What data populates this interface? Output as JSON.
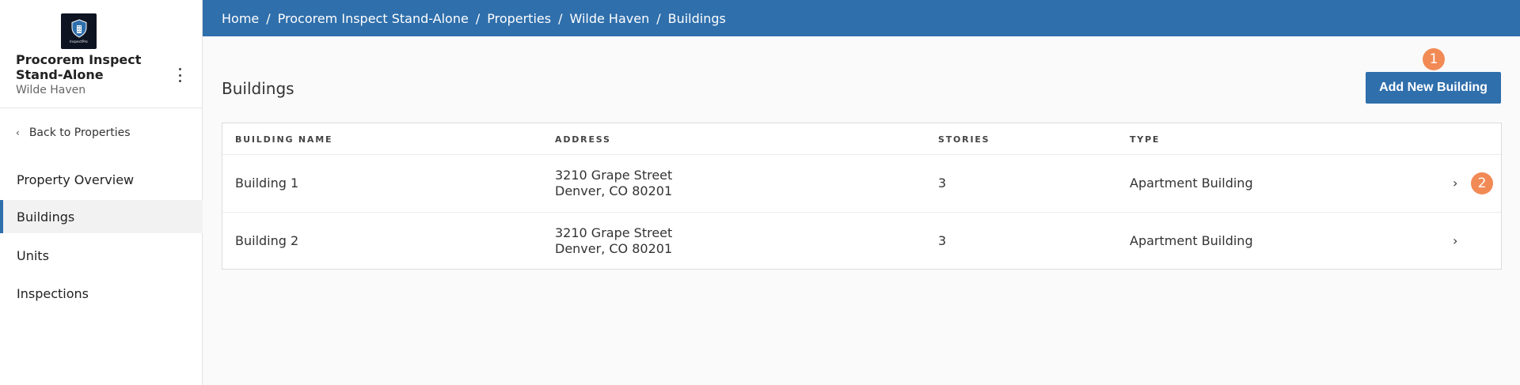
{
  "sidebar": {
    "logo_text": "InspectPro",
    "org_name": "Procorem Inspect Stand-Alone",
    "org_sub": "Wilde Haven",
    "back_label": "Back to Properties",
    "nav": [
      {
        "label": "Property Overview",
        "active": false
      },
      {
        "label": "Buildings",
        "active": true
      },
      {
        "label": "Units",
        "active": false
      },
      {
        "label": "Inspections",
        "active": false
      }
    ]
  },
  "breadcrumb": [
    "Home",
    "Procorem Inspect Stand-Alone",
    "Properties",
    "Wilde Haven",
    "Buildings"
  ],
  "main": {
    "title": "Buildings",
    "add_button": "Add New Building",
    "badge_1": "1",
    "badge_2": "2"
  },
  "table": {
    "headers": [
      "BUILDING NAME",
      "ADDRESS",
      "STORIES",
      "TYPE"
    ],
    "rows": [
      {
        "name": "Building 1",
        "address_line1": "3210 Grape Street",
        "address_line2": "Denver, CO 80201",
        "stories": "3",
        "type": "Apartment Building"
      },
      {
        "name": "Building 2",
        "address_line1": "3210 Grape Street",
        "address_line2": "Denver, CO 80201",
        "stories": "3",
        "type": "Apartment Building"
      }
    ]
  },
  "colors": {
    "accent": "#2f6fac",
    "badge": "#f28a55"
  },
  "icons": {
    "row_chevron": "chevron-right-icon",
    "back": "chevron-left-icon",
    "more": "kebab-menu-icon"
  }
}
